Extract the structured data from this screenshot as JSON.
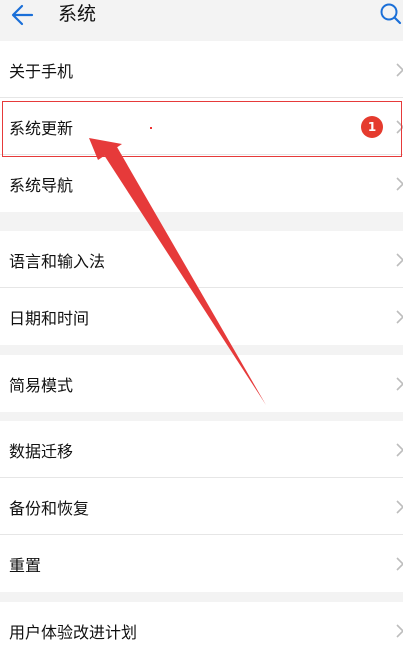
{
  "header": {
    "title": "系统",
    "back_icon": "back-arrow-icon",
    "search_icon": "search-icon"
  },
  "colors": {
    "accent": "#1a6fd8",
    "badge": "#e53b2e",
    "annotation": "#e63a3a",
    "background": "#f3f3f3"
  },
  "groups": [
    {
      "items": [
        {
          "label": "关于手机"
        },
        {
          "label": "系统更新",
          "badge": "1",
          "highlighted": true
        },
        {
          "label": "系统导航"
        }
      ]
    },
    {
      "items": [
        {
          "label": "语言和输入法"
        },
        {
          "label": "日期和时间"
        }
      ]
    },
    {
      "items": [
        {
          "label": "简易模式"
        }
      ]
    },
    {
      "items": [
        {
          "label": "数据迁移"
        },
        {
          "label": "备份和恢复"
        },
        {
          "label": "重置"
        }
      ]
    },
    {
      "items": [
        {
          "label": "用户体验改进计划"
        }
      ]
    }
  ]
}
